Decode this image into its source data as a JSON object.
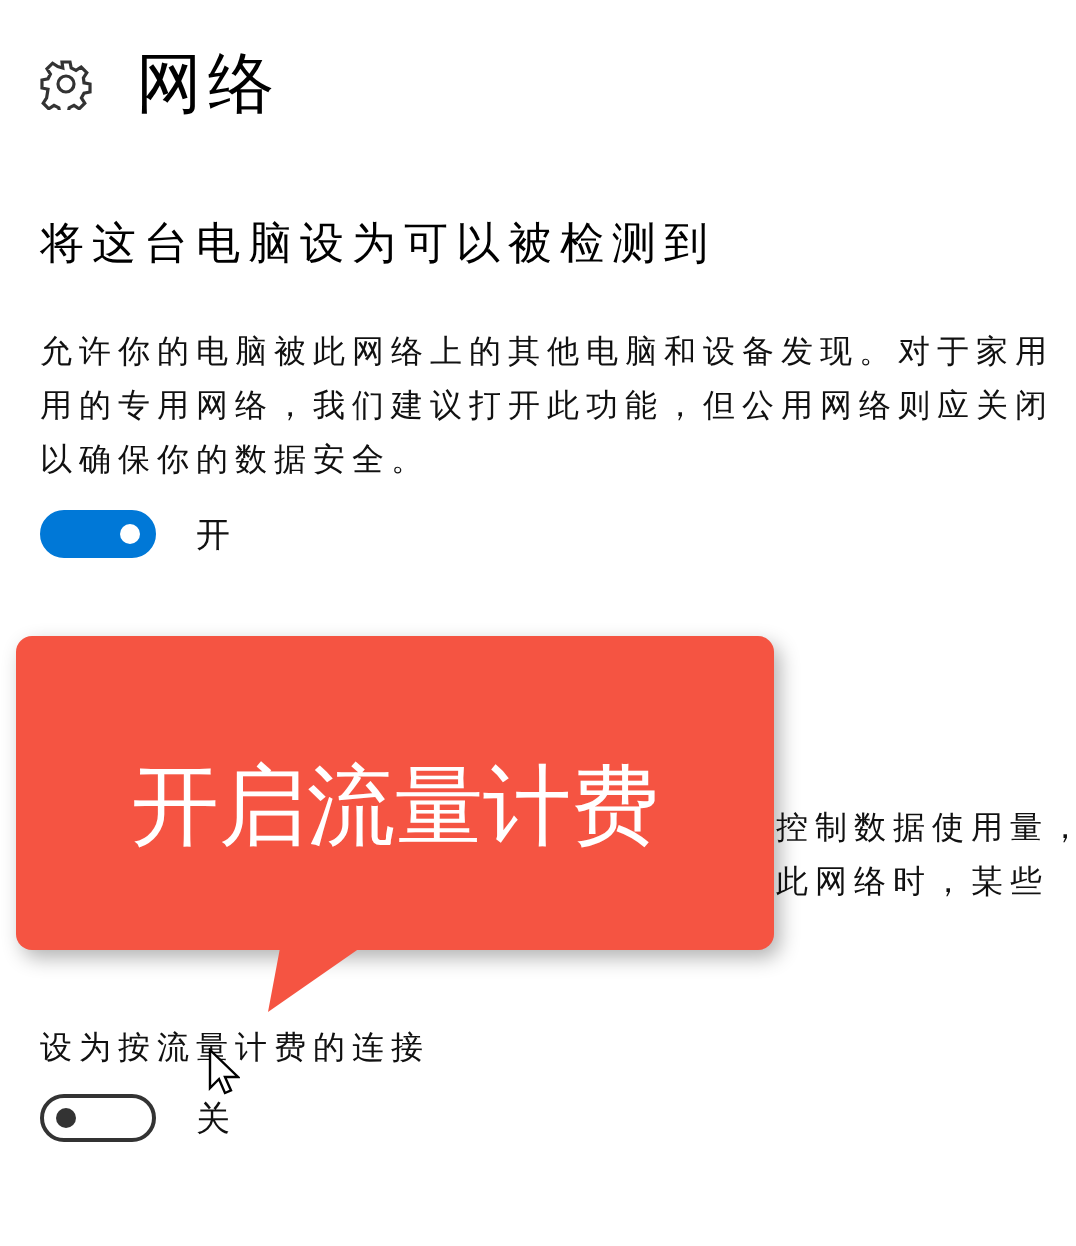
{
  "header": {
    "title": "网络"
  },
  "discovery": {
    "heading": "将这台电脑设为可以被检测到",
    "description_lines": [
      "允许你的电脑被此网络上的其他电脑和设备发现。对于家用",
      "用的专用网络，我们建议打开此功能，但公用网络则应关闭",
      "以确保你的数据安全。"
    ],
    "toggle": {
      "on": true,
      "label": "开"
    }
  },
  "metered": {
    "description_lines": [
      "控制数据使用量，",
      "此网络时，某些"
    ],
    "setting_label": "设为按流量计费的连接",
    "toggle": {
      "on": false,
      "label": "关"
    }
  },
  "callout": {
    "text": "开启流量计费"
  }
}
